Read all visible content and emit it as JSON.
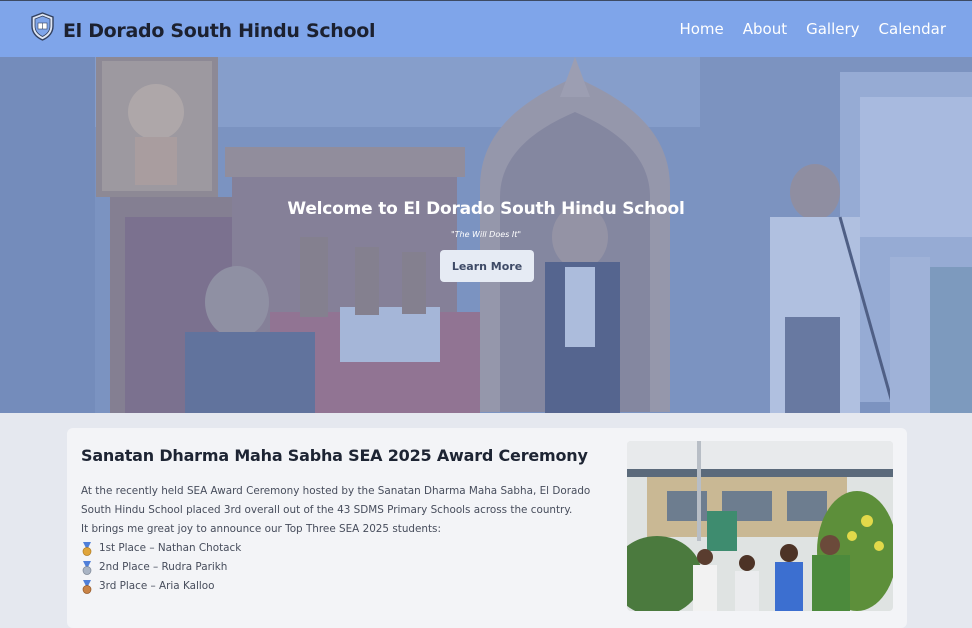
{
  "header": {
    "site_title": "El Dorado South Hindu School",
    "background": "#7fa5ea",
    "logo_icon": "school-crest-icon"
  },
  "nav": {
    "items": [
      {
        "label": "Home"
      },
      {
        "label": "About"
      },
      {
        "label": "Gallery"
      },
      {
        "label": "Calendar"
      }
    ]
  },
  "hero": {
    "title": "Welcome to El Dorado South Hindu School",
    "motto": "\"The Will Does It\"",
    "button_label": "Learn More"
  },
  "article": {
    "title": "Sanatan Dharma Maha Sabha SEA 2025 Award Ceremony",
    "paragraph": "At the recently held SEA Award Ceremony hosted by the Sanatan Dharma Maha Sabha, El Dorado South Hindu School placed 3rd overall out of the 43 SDMS Primary Schools across the country.",
    "intro": "It brings me great joy to announce our Top Three SEA 2025 students:",
    "places": [
      {
        "text": "1st Place – Nathan Chotack",
        "medal_icon": "gold-medal-icon",
        "color": "#e0a53a"
      },
      {
        "text": "2nd Place – Rudra Parikh",
        "medal_icon": "silver-medal-icon",
        "color": "#a9b4c4"
      },
      {
        "text": "3rd Place – Aria Kalloo",
        "medal_icon": "bronze-medal-icon",
        "color": "#c98346"
      }
    ]
  }
}
